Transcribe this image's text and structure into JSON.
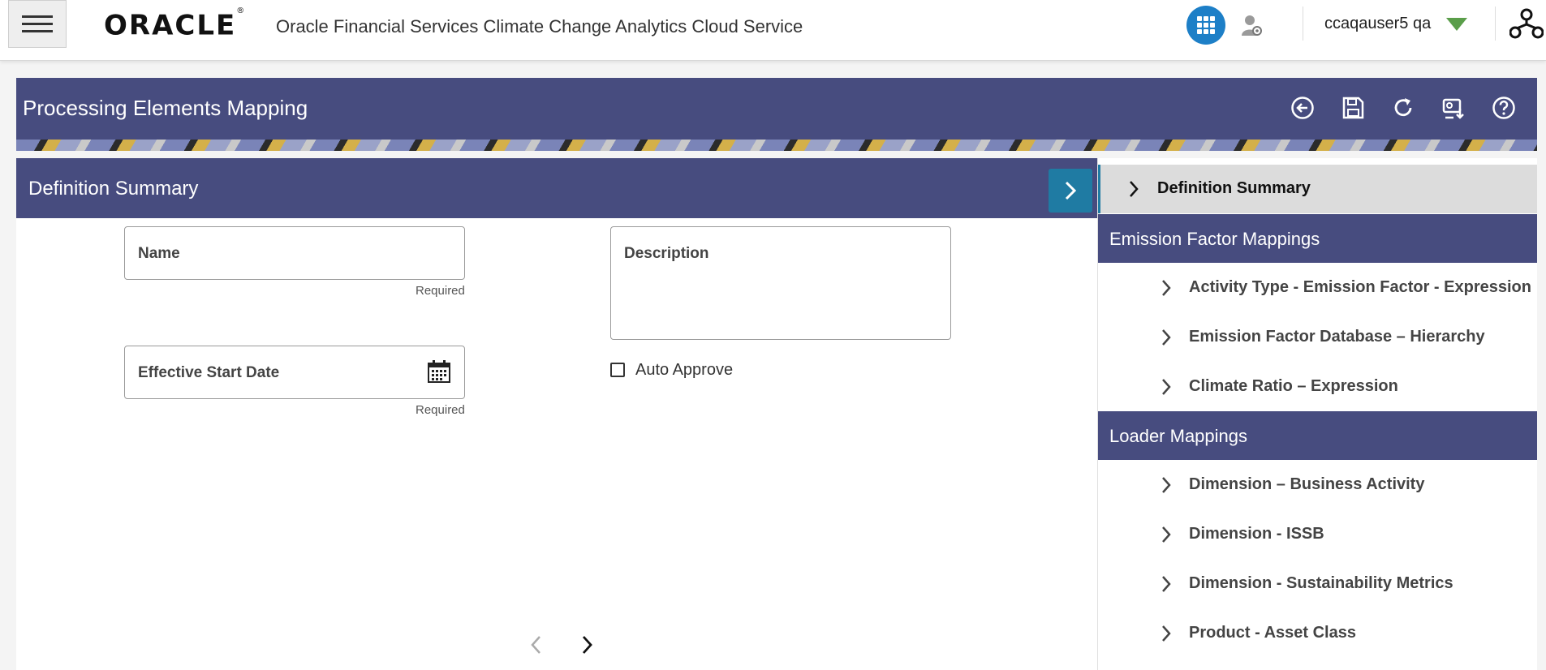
{
  "header": {
    "logo_text": "ORACLE",
    "logo_mark": "®",
    "app_title": "Oracle Financial Services Climate Change Analytics Cloud Service",
    "user_name": "ccaqauser5 qa",
    "icons": [
      "hamburger-icon",
      "apps-grid-icon",
      "user-settings-icon",
      "caret-down-icon",
      "hierarchy-icon"
    ]
  },
  "page": {
    "title": "Processing Elements Mapping",
    "toolbar_icons": [
      "back-icon",
      "save-icon",
      "refresh-icon",
      "export-icon",
      "help-icon"
    ]
  },
  "form": {
    "section_title": "Definition Summary",
    "name_label": "Name",
    "name_required": "Required",
    "description_label": "Description",
    "start_date_label": "Effective Start Date",
    "start_date_required": "Required",
    "auto_approve_label": "Auto Approve",
    "auto_approve_checked": false
  },
  "nav": {
    "active_label": "Definition Summary",
    "groups": [
      {
        "label": "Emission Factor Mappings",
        "items": [
          "Activity Type - Emission Factor - Expression",
          "Emission Factor Database – Hierarchy",
          "Climate Ratio – Expression"
        ]
      },
      {
        "label": "Loader Mappings",
        "items": [
          "Dimension – Business Activity",
          "Dimension - ISSB",
          "Dimension - Sustainability Metrics",
          "Product - Asset Class"
        ]
      }
    ]
  },
  "colors": {
    "header_band": "#474c7f",
    "accent_button": "#1f7ba3",
    "apps_button": "#1d7fc7",
    "user_caret": "#5a9e4a"
  }
}
